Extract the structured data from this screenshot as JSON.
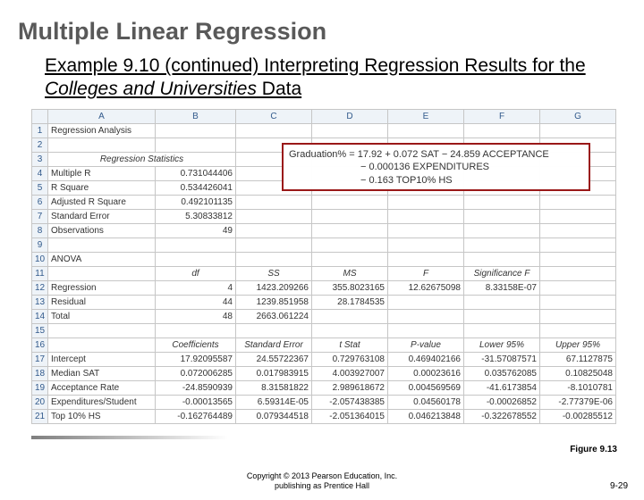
{
  "title": "Multiple Linear Regression",
  "subtitle_a": "Example 9.10 (continued) Interpreting Regression Results for the ",
  "subtitle_b": "Colleges and Universities",
  "subtitle_c": " Data",
  "cols": [
    "A",
    "B",
    "C",
    "D",
    "E",
    "F",
    "G"
  ],
  "rows": [
    "1",
    "2",
    "3",
    "4",
    "5",
    "6",
    "7",
    "8",
    "9",
    "10",
    "11",
    "12",
    "13",
    "14",
    "15",
    "16",
    "17",
    "18",
    "19",
    "20",
    "21"
  ],
  "r1": {
    "a": "Regression Analysis"
  },
  "r3": {
    "section": "Regression Statistics"
  },
  "r4": {
    "a": "Multiple R",
    "b": "0.731044406"
  },
  "r5": {
    "a": "R Square",
    "b": "0.534426041"
  },
  "r6": {
    "a": "Adjusted R Square",
    "b": "0.492101135"
  },
  "r7": {
    "a": "Standard Error",
    "b": "5.30833812"
  },
  "r8": {
    "a": "Observations",
    "b": "49"
  },
  "r10": {
    "a": "ANOVA"
  },
  "r11": {
    "b": "df",
    "c": "SS",
    "d": "MS",
    "e": "F",
    "f": "Significance F"
  },
  "r12": {
    "a": "Regression",
    "b": "4",
    "c": "1423.209266",
    "d": "355.8023165",
    "e": "12.62675098",
    "f": "8.33158E-07"
  },
  "r13": {
    "a": "Residual",
    "b": "44",
    "c": "1239.851958",
    "d": "28.1784535"
  },
  "r14": {
    "a": "Total",
    "b": "48",
    "c": "2663.061224"
  },
  "r16": {
    "b": "Coefficients",
    "c": "Standard Error",
    "d": "t Stat",
    "e": "P-value",
    "f": "Lower 95%",
    "g": "Upper 95%"
  },
  "r17": {
    "a": "Intercept",
    "b": "17.92095587",
    "c": "24.55722367",
    "d": "0.729763108",
    "e": "0.469402166",
    "f": "-31.57087571",
    "g": "67.1127875"
  },
  "r18": {
    "a": "Median SAT",
    "b": "0.072006285",
    "c": "0.017983915",
    "d": "4.003927007",
    "e": "0.00023616",
    "f": "0.035762085",
    "g": "0.10825048"
  },
  "r19": {
    "a": "Acceptance Rate",
    "b": "-24.8590939",
    "c": "8.31581822",
    "d": "2.989618672",
    "e": "0.004569569",
    "f": "-41.6173854",
    "g": "-8.1010781"
  },
  "r20": {
    "a": "Expenditures/Student",
    "b": "-0.00013565",
    "c": "6.59314E-05",
    "d": "-2.057438385",
    "e": "0.04560178",
    "f": "-0.00026852",
    "g": "-2.77379E-06"
  },
  "r21": {
    "a": "Top 10% HS",
    "b": "-0.162764489",
    "c": "0.079344518",
    "d": "-2.051364015",
    "e": "0.046213848",
    "f": "-0.322678552",
    "g": "-0.00285512"
  },
  "formula": {
    "l1": "Graduation% = 17.92 + 0.072 SAT − 24.859 ACCEPTANCE",
    "l2": "− 0.000136 EXPENDITURES",
    "l3": "− 0.163 TOP10% HS"
  },
  "figcap": "Figure 9.13",
  "copyright_l1": "Copyright © 2013 Pearson Education, Inc.",
  "copyright_l2": "publishing as Prentice Hall",
  "slidenum": "9-29",
  "chart_data": {
    "type": "table",
    "title": "Multiple Linear Regression Output — Colleges and Universities",
    "regression_stats": {
      "Multiple R": 0.731044406,
      "R Square": 0.534426041,
      "Adjusted R Square": 0.492101135,
      "Standard Error": 5.30833812,
      "Observations": 49
    },
    "anova": [
      {
        "source": "Regression",
        "df": 4,
        "SS": 1423.209266,
        "MS": 355.8023165,
        "F": 12.62675098,
        "Significance F": 8.33158e-07
      },
      {
        "source": "Residual",
        "df": 44,
        "SS": 1239.851958,
        "MS": 28.1784535
      },
      {
        "source": "Total",
        "df": 48,
        "SS": 2663.061224
      }
    ],
    "coefficients": [
      {
        "term": "Intercept",
        "coef": 17.92095587,
        "se": 24.55722367,
        "t": 0.729763108,
        "p": 0.469402166,
        "lower95": -31.57087571,
        "upper95": 67.1127875
      },
      {
        "term": "Median SAT",
        "coef": 0.072006285,
        "se": 0.017983915,
        "t": 4.003927007,
        "p": 0.00023616,
        "lower95": 0.035762085,
        "upper95": 0.10825048
      },
      {
        "term": "Acceptance Rate",
        "coef": -24.8590939,
        "se": 8.31581822,
        "t": 2.989618672,
        "p": 0.004569569,
        "lower95": -41.6173854,
        "upper95": -8.1010781
      },
      {
        "term": "Expenditures/Student",
        "coef": -0.00013565,
        "se": 6.59314e-05,
        "t": -2.057438385,
        "p": 0.04560178,
        "lower95": -0.00026852,
        "upper95": -2.77379e-06
      },
      {
        "term": "Top 10% HS",
        "coef": -0.162764489,
        "se": 0.079344518,
        "t": -2.051364015,
        "p": 0.046213848,
        "lower95": -0.322678552,
        "upper95": -0.00285512
      }
    ],
    "equation": "Graduation% = 17.92 + 0.072*SAT - 24.859*ACCEPTANCE - 0.000136*EXPENDITURES - 0.163*TOP10%HS"
  }
}
